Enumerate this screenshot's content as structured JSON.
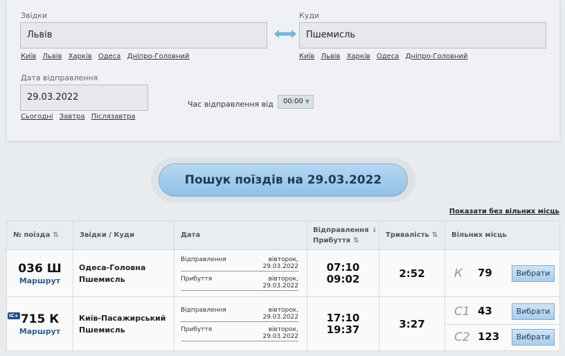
{
  "from": {
    "label": "Звідки",
    "value": "Львів",
    "quick": [
      "Київ",
      "Львів",
      "Харків",
      "Одеса",
      "Дніпро-Головний"
    ]
  },
  "to": {
    "label": "Куди",
    "value": "Пшемисль",
    "quick": [
      "Київ",
      "Львів",
      "Харків",
      "Одеса",
      "Дніпро-Головний"
    ]
  },
  "date": {
    "label": "Дата відправлення",
    "value": "29.03.2022",
    "quick": [
      "Сьогодні",
      "Завтра",
      "Післязавтра"
    ]
  },
  "time": {
    "label": "Час відправлення від",
    "value": "00:00"
  },
  "search_button": "Пошук поїздів на 29.03.2022",
  "show_no_seats": "Показати без вільних місць",
  "headers": {
    "number": "№ поїзда",
    "route": "Звідки / Куди",
    "date": "Дата",
    "departure": "Відправлення",
    "arrival": "Прибуття",
    "duration": "Тривалість",
    "seats": "Вільних місць"
  },
  "trains": [
    {
      "number": "036 Ш",
      "route_link": "Маршрут",
      "badge": "",
      "from": "Одеса-Головна",
      "to": "Пшемисль",
      "dep_label": "Відправлення",
      "dep_date": "вівторок, 29.03.2022",
      "arr_label": "Прибуття",
      "arr_date": "вівторок, 29.03.2022",
      "dep_time": "07:10",
      "arr_time": "09:02",
      "duration": "2:52",
      "seats": [
        {
          "class": "К",
          "count": "79",
          "button": "Вибрати"
        }
      ]
    },
    {
      "number": "715 К",
      "route_link": "Маршрут",
      "badge": "IC+",
      "from": "Київ-Пасажирський",
      "to": "Пшемисль",
      "dep_label": "Відправлення",
      "dep_date": "вівторок, 29.03.2022",
      "arr_label": "Прибуття",
      "arr_date": "вівторок, 29.03.2022",
      "dep_time": "17:10",
      "arr_time": "19:37",
      "duration": "3:27",
      "seats": [
        {
          "class": "С1",
          "count": "43",
          "button": "Вибрати"
        },
        {
          "class": "С2",
          "count": "123",
          "button": "Вибрати"
        }
      ]
    }
  ]
}
